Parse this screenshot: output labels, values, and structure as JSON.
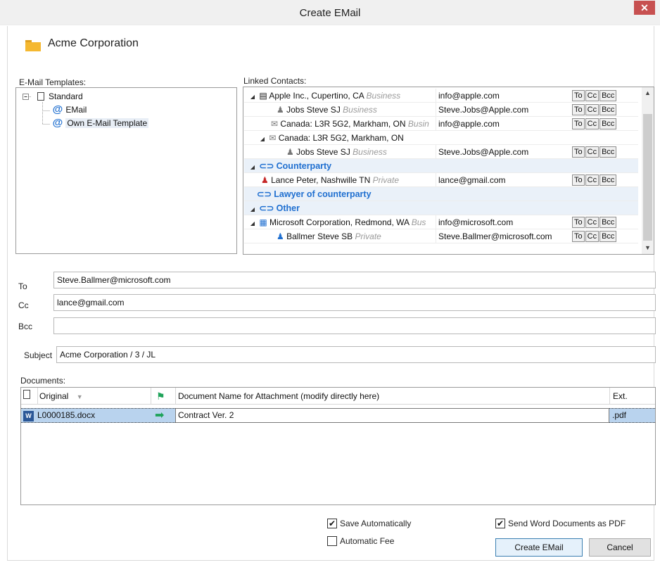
{
  "window": {
    "title": "Create EMail",
    "close_glyph": "✕"
  },
  "company": "Acme Corporation",
  "templates": {
    "label": "E-Mail Templates:",
    "root": "Standard",
    "items": [
      "EMail",
      "Own E-Mail Template"
    ]
  },
  "contacts": {
    "label": "Linked Contacts:",
    "rows": [
      {
        "name": "Apple Inc., Cupertino, CA",
        "category": "Business",
        "email": "info@apple.com"
      },
      {
        "name": "Jobs Steve  SJ",
        "category": "Business",
        "email": "Steve.Jobs@Apple.com"
      },
      {
        "name": "Canada: L3R 5G2, Markham, ON",
        "category": "Busin",
        "email": "info@apple.com"
      },
      {
        "name": "Canada: L3R 5G2, Markham, ON",
        "category": "",
        "email": ""
      },
      {
        "name": "Jobs Steve  SJ",
        "category": "Business",
        "email": "Steve.Jobs@Apple.com"
      },
      {
        "name": "Counterparty",
        "category": "",
        "email": ""
      },
      {
        "name": "Lance Peter, Nashwille TN",
        "category": "Private",
        "email": "lance@gmail.com"
      },
      {
        "name": "Lawyer of counterparty",
        "category": "",
        "email": ""
      },
      {
        "name": "Other",
        "category": "",
        "email": ""
      },
      {
        "name": "Microsoft Corporation, Redmond, WA",
        "category": "Bus",
        "email": "info@microsoft.com"
      },
      {
        "name": "Ballmer Steve  SB",
        "category": "Private",
        "email": "Steve.Ballmer@microsoft.com"
      }
    ],
    "to": "To",
    "cc": "Cc",
    "bcc": "Bcc"
  },
  "fields": {
    "to_label": "To",
    "to_value": "Steve.Ballmer@microsoft.com",
    "cc_label": "Cc",
    "cc_value": "lance@gmail.com",
    "bcc_label": "Bcc",
    "bcc_value": "",
    "subject_label": "Subject",
    "subject_value": "Acme Corporation / 3 / JL"
  },
  "documents": {
    "label": "Documents:",
    "col_original": "Original",
    "col_name": "Document Name for Attachment (modify directly here)",
    "col_ext": "Ext.",
    "rows": [
      {
        "original": "L0000185.docx",
        "name": "Contract Ver. 2",
        "ext": ".pdf"
      }
    ]
  },
  "options": {
    "save_auto": "Save Automatically",
    "auto_fee": "Automatic Fee",
    "send_pdf": "Send Word Documents as PDF",
    "save_auto_checked": true,
    "auto_fee_checked": false,
    "send_pdf_checked": true,
    "check_glyph": "✔"
  },
  "buttons": {
    "create": "Create EMail",
    "cancel": "Cancel"
  },
  "colors": {
    "accent": "#1f6fd0",
    "selection": "#b9d3ee",
    "group": "#1f6fd0",
    "close": "#c75050",
    "green_arrow": "#1fa35a"
  }
}
